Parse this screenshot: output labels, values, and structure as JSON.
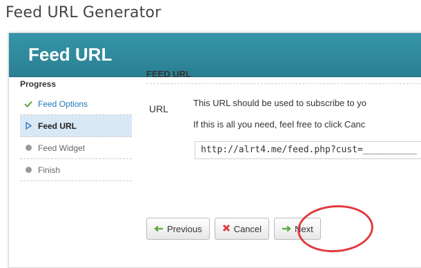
{
  "window": {
    "title": "Feed URL Generator"
  },
  "modal": {
    "title": "Feed URL"
  },
  "sidebar": {
    "progress_label": "Progress",
    "steps": [
      {
        "label": "Feed Options",
        "state": "done",
        "icon": "check-icon"
      },
      {
        "label": "Feed URL",
        "state": "active",
        "icon": "triangle-right-icon"
      },
      {
        "label": "Feed Widget",
        "state": "pending",
        "icon": "dot-icon"
      },
      {
        "label": "Finish",
        "state": "pending",
        "icon": "dot-icon"
      }
    ]
  },
  "content": {
    "section_title": "FEED URL",
    "url_label": "URL",
    "description_line1": "This URL should be used to subscribe to yo",
    "description_line2": "If this is all you need, feel free to click Canc",
    "url_value": "http://alrt4.me/feed.php?cust=__________"
  },
  "buttons": {
    "previous": "Previous",
    "cancel": "Cancel",
    "next": "Next"
  },
  "colors": {
    "header": "#2f8a9e",
    "done": "#6aa84f",
    "cancel": "#e03a3a",
    "arrows": "#5aa839",
    "highlight": "#e2393f"
  }
}
